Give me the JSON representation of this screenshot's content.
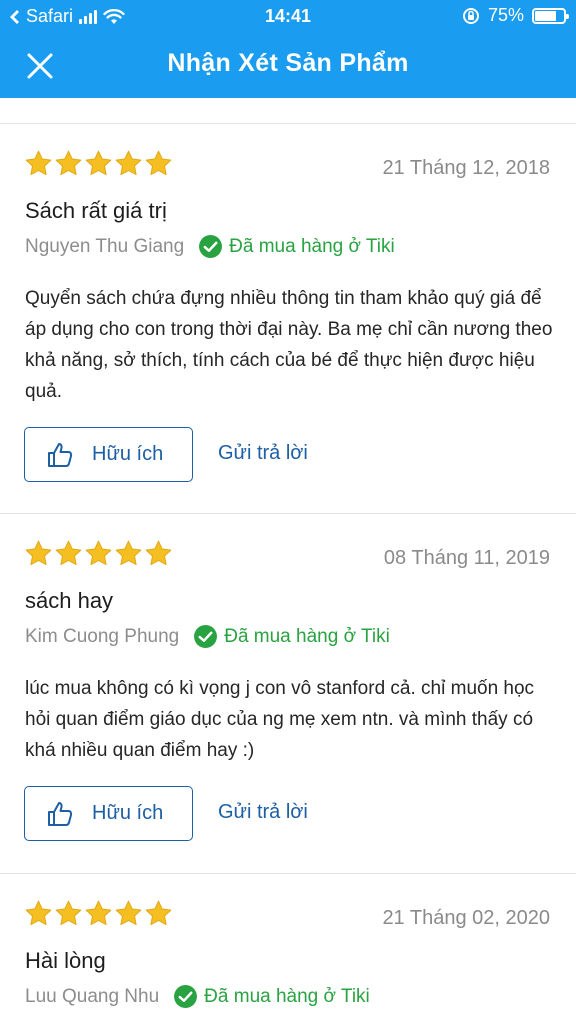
{
  "status_bar": {
    "carrier": "Safari",
    "time": "14:41",
    "battery_percent": "75%",
    "battery_level": 0.75,
    "icons": [
      "signal-icon",
      "wifi-icon",
      "rotation-lock-icon",
      "battery-icon"
    ]
  },
  "nav": {
    "title": "Nhận Xét Sản Phẩm",
    "close_icon": "close-icon"
  },
  "colors": {
    "header": "#1a9cf0",
    "star": "#f5bf22",
    "verified": "#29a341",
    "link": "#1d5fa5"
  },
  "reviews": [
    {
      "rating": 5,
      "date": "21 Tháng 12, 2018",
      "title": "Sách rất giá trị",
      "author": "Nguyen Thu Giang",
      "verified_label": "Đã mua hàng ở Tiki",
      "body": "Quyển sách chứa đựng nhiều thông tin tham khảo quý giá để áp dụng cho con trong thời đại này. Ba mẹ chỉ cần nương theo khả năng, sở thích, tính cách của bé để thực hiện được hiệu quả.",
      "helpful_label": "Hữu ích",
      "reply_label": "Gửi trả lời"
    },
    {
      "rating": 5,
      "date": "08 Tháng 11, 2019",
      "title": "sách hay",
      "author": "Kim Cuong Phung",
      "verified_label": "Đã mua hàng ở Tiki",
      "body": "lúc mua không có kì vọng j con vô stanford cả. chỉ muốn học hỏi quan điểm giáo dục của ng mẹ xem ntn. và mình thấy có khá nhiều quan điểm hay :)",
      "helpful_label": "Hữu ích",
      "reply_label": "Gửi trả lời"
    },
    {
      "rating": 5,
      "date": "21 Tháng 02, 2020",
      "title": "Hài lòng",
      "author": "Luu Quang Nhu",
      "verified_label": "Đã mua hàng ở Tiki"
    }
  ]
}
